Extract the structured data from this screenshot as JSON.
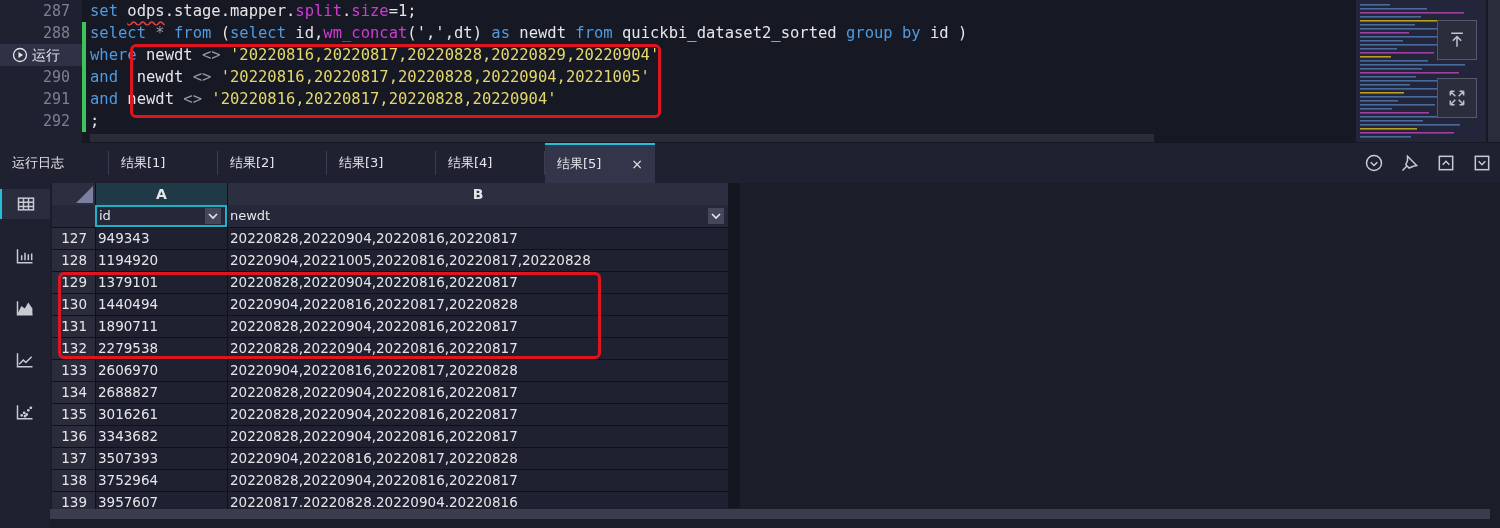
{
  "editor": {
    "lines": [
      {
        "gutter": {
          "kind": "number",
          "text": "287"
        },
        "changed": false,
        "tokens": [
          {
            "kind": "keyword",
            "text": "set "
          },
          {
            "kind": "flagged",
            "text": "odps"
          },
          {
            "kind": "plain",
            "text": ".stage.mapper."
          },
          {
            "kind": "func",
            "text": "split"
          },
          {
            "kind": "plain",
            "text": "."
          },
          {
            "kind": "func",
            "text": "size"
          },
          {
            "kind": "plain",
            "text": "=1;"
          }
        ]
      },
      {
        "gutter": {
          "kind": "number",
          "text": "288"
        },
        "changed": true,
        "tokens": [
          {
            "kind": "keyword",
            "text": "select "
          },
          {
            "kind": "op",
            "text": "* "
          },
          {
            "kind": "keyword",
            "text": "from "
          },
          {
            "kind": "plain",
            "text": "("
          },
          {
            "kind": "keyword",
            "text": "select "
          },
          {
            "kind": "plain",
            "text": "id,"
          },
          {
            "kind": "func",
            "text": "wm_concat"
          },
          {
            "kind": "plain",
            "text": "(',',dt) "
          },
          {
            "kind": "keyword",
            "text": "as "
          },
          {
            "kind": "plain",
            "text": "newdt "
          },
          {
            "kind": "keyword",
            "text": "from "
          },
          {
            "kind": "plain",
            "text": "quickbi_dataset2_sorted "
          },
          {
            "kind": "keyword",
            "text": "group by "
          },
          {
            "kind": "plain",
            "text": "id )"
          }
        ]
      },
      {
        "gutter": {
          "kind": "run_button",
          "text": "运行"
        },
        "changed": true,
        "tokens": [
          {
            "kind": "keyword",
            "text": "where "
          },
          {
            "kind": "plain",
            "text": "newdt "
          },
          {
            "kind": "op",
            "text": "<> "
          },
          {
            "kind": "string",
            "text": "'20220816,20220817,20220828,20220829,20220904'"
          }
        ]
      },
      {
        "gutter": {
          "kind": "number",
          "text": "290"
        },
        "changed": true,
        "tokens": [
          {
            "kind": "keyword",
            "text": "and  "
          },
          {
            "kind": "plain",
            "text": "newdt "
          },
          {
            "kind": "op",
            "text": "<> "
          },
          {
            "kind": "string",
            "text": "'20220816,20220817,20220828,20220904,20221005'"
          }
        ]
      },
      {
        "gutter": {
          "kind": "number",
          "text": "291"
        },
        "changed": true,
        "tokens": [
          {
            "kind": "keyword",
            "text": "and "
          },
          {
            "kind": "plain",
            "text": "newdt "
          },
          {
            "kind": "op",
            "text": "<> "
          },
          {
            "kind": "string",
            "text": "'20220816,20220817,20220828,20220904'"
          }
        ]
      },
      {
        "gutter": {
          "kind": "number",
          "text": "292"
        },
        "changed": true,
        "tokens": [
          {
            "kind": "plain",
            "text": ";"
          }
        ]
      }
    ]
  },
  "tabs": [
    {
      "label": "运行日志",
      "selected": false
    },
    {
      "label": "结果[1]",
      "selected": false
    },
    {
      "label": "结果[2]",
      "selected": false
    },
    {
      "label": "结果[3]",
      "selected": false
    },
    {
      "label": "结果[4]",
      "selected": false
    },
    {
      "label": "结果[5]",
      "selected": true,
      "close": "×"
    }
  ],
  "side_views": [
    {
      "kind": "table",
      "selected": true
    },
    {
      "kind": "bar",
      "selected": false
    },
    {
      "kind": "area",
      "selected": false
    },
    {
      "kind": "line",
      "selected": false
    },
    {
      "kind": "scatter",
      "selected": false
    }
  ],
  "table": {
    "columns": [
      {
        "letter": "A",
        "header": "id",
        "selected": true
      },
      {
        "letter": "B",
        "header": "newdt",
        "selected": false
      }
    ],
    "rows": [
      {
        "number": "127",
        "id": "949343",
        "newdt": "20220828,20220904,20220816,20220817"
      },
      {
        "number": "128",
        "id": "1194920",
        "newdt": "20220904,20221005,20220816,20220817,20220828"
      },
      {
        "number": "129",
        "id": "1379101",
        "newdt": "20220828,20220904,20220816,20220817"
      },
      {
        "number": "130",
        "id": "1440494",
        "newdt": "20220904,20220816,20220817,20220828"
      },
      {
        "number": "131",
        "id": "1890711",
        "newdt": "20220828,20220904,20220816,20220817"
      },
      {
        "number": "132",
        "id": "2279538",
        "newdt": "20220828,20220904,20220816,20220817"
      },
      {
        "number": "133",
        "id": "2606970",
        "newdt": "20220904,20220816,20220817,20220828"
      },
      {
        "number": "134",
        "id": "2688827",
        "newdt": "20220828,20220904,20220816,20220817"
      },
      {
        "number": "135",
        "id": "3016261",
        "newdt": "20220828,20220904,20220816,20220817"
      },
      {
        "number": "136",
        "id": "3343682",
        "newdt": "20220828,20220904,20220816,20220817"
      },
      {
        "number": "137",
        "id": "3507393",
        "newdt": "20220904,20220816,20220817,20220828"
      },
      {
        "number": "138",
        "id": "3752964",
        "newdt": "20220828,20220904,20220816,20220817"
      },
      {
        "number": "139",
        "id": "3957607",
        "newdt": "20220817.20220828.20220904.20220816"
      }
    ]
  }
}
